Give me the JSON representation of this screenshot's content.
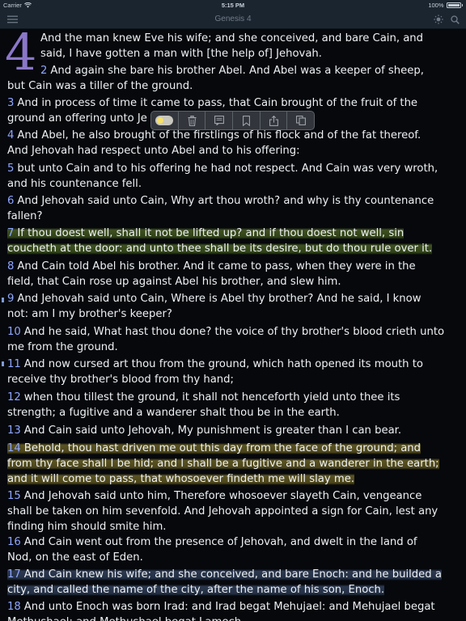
{
  "status_bar": {
    "carrier": "Carrier",
    "time": "5:15 PM",
    "battery": "100%"
  },
  "nav": {
    "title": "Genesis 4"
  },
  "dropcap": "4",
  "verses": [
    {
      "num": "",
      "lines": [
        "And the man knew Eve his wife; and she conceived, and bare Cain, and",
        "said, I have gotten a man with [the help of] Jehovah."
      ]
    },
    {
      "num": "2",
      "lines": [
        "And again she bare his brother Abel. And Abel was a keeper of sheep,",
        "but Cain was a tiller of the ground."
      ]
    },
    {
      "num": "3",
      "lines": [
        "And in process of time it came to pass, that Cain brought of the fruit of the",
        "ground an offering unto Je"
      ]
    },
    {
      "num": "4",
      "lines": [
        "And Abel, he also brought of the firstlings of his flock and of the fat thereof.",
        "And Jehovah had respect unto Abel and to his offering:"
      ]
    },
    {
      "num": "5",
      "lines": [
        "but unto Cain and to his offering he had not respect. And Cain was very wroth,",
        "and his countenance fell."
      ]
    },
    {
      "num": "6",
      "lines": [
        "And Jehovah said unto Cain, Why art thou wroth? and why is thy countenance",
        "fallen?"
      ]
    },
    {
      "num": "7",
      "lines": [
        "If thou doest well, shall it not be lifted up? and if thou doest not well, sin",
        "coucheth at the door: and unto thee shall be its desire, but do thou rule over it."
      ]
    },
    {
      "num": "8",
      "lines": [
        "And Cain told Abel his brother. And it came to pass, when they were in the",
        "field, that Cain rose up against Abel his brother, and slew him."
      ]
    },
    {
      "num": "9",
      "lines": [
        "And Jehovah said unto Cain, Where is Abel thy brother? And he said, I know",
        "not: am I my brother's keeper?"
      ]
    },
    {
      "num": "10",
      "lines": [
        "And he said, What hast thou done? the voice of thy brother's blood crieth unto",
        "me from the ground."
      ]
    },
    {
      "num": "11",
      "lines": [
        "And now cursed art thou from the ground, which hath opened its mouth to",
        "receive thy brother's blood from thy hand;"
      ]
    },
    {
      "num": "12",
      "lines": [
        "when thou tillest the ground, it shall not henceforth yield unto thee its",
        "strength; a fugitive and a wanderer shalt thou be in the earth."
      ]
    },
    {
      "num": "13",
      "lines": [
        "And Cain said unto Jehovah, My punishment is greater than I can bear."
      ]
    },
    {
      "num": "14",
      "lines": [
        "Behold, thou hast driven me out this day from the face of the ground; and",
        "from thy face shall I be hid; and I shall be a fugitive and a wanderer in the earth;",
        "and it will come to pass, that whosoever findeth me will slay me."
      ]
    },
    {
      "num": "15",
      "lines": [
        "And Jehovah said unto him, Therefore whosoever slayeth Cain, vengeance",
        "shall be taken on him sevenfold. And Jehovah appointed a sign for Cain, lest any",
        "finding him should smite him."
      ]
    },
    {
      "num": "16",
      "lines": [
        "And Cain went out from the presence of Jehovah, and dwelt in the land of",
        "Nod, on the east of Eden."
      ]
    },
    {
      "num": "17",
      "lines": [
        "And Cain knew his wife; and she conceived, and bare Enoch: and he builded a",
        "city, and called the name of the city, after the name of his son, Enoch."
      ]
    },
    {
      "num": "18",
      "lines": [
        "And unto Enoch was born Irad: and Irad begat Mehujael: and Mehujael begat",
        "Methushael: and Methushael begat Lamech."
      ]
    }
  ],
  "toolbar": {
    "items": [
      "toggle-icon",
      "trash-icon",
      "note-icon",
      "bookmark-icon",
      "share-icon",
      "copy-icon"
    ]
  },
  "colors": {
    "background": "#06080c",
    "bar": "#1b2530",
    "verse_number": "#8ea6ff",
    "dropcap": "#8b77c9",
    "highlight_green": "#485d24",
    "highlight_yellow": "#696026",
    "highlight_blue": "#303e56"
  }
}
